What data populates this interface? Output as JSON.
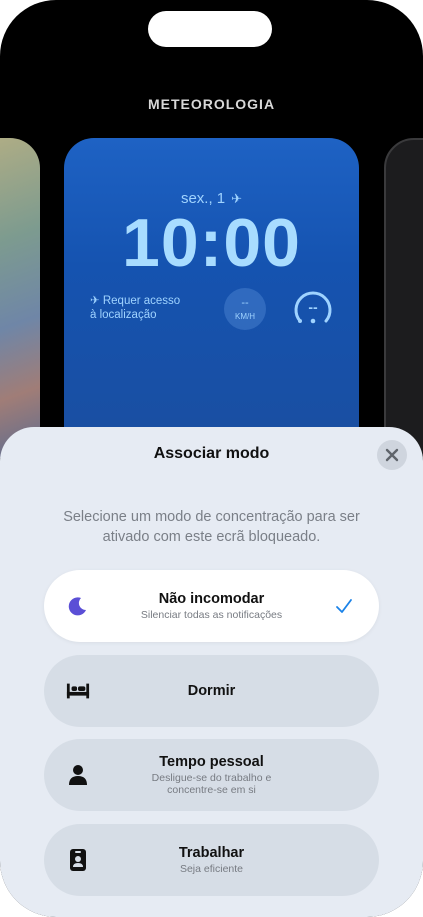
{
  "header": {
    "title": "METEOROLOGIA"
  },
  "lock_preview": {
    "date": "sex., 1",
    "time": "10:00",
    "location_text_line1": "Requer acesso",
    "location_text_line2": "à localização",
    "wind_value": "--",
    "wind_unit": "KM/H",
    "gauge_value": "--"
  },
  "sheet": {
    "title": "Associar modo",
    "description": "Selecione um modo de concentração para ser ativado com este ecrã bloqueado.",
    "close_icon": "xmark-icon",
    "modes": [
      {
        "name": "Não incomodar",
        "subtitle": "Silenciar todas as notificações",
        "icon": "moon-icon",
        "icon_color": "#5b4fd6",
        "selected": true
      },
      {
        "name": "Dormir",
        "subtitle": "",
        "icon": "bed-icon",
        "selected": false
      },
      {
        "name": "Tempo pessoal",
        "subtitle_line1": "Desligue-se do trabalho e",
        "subtitle_line2": "concentre-se em si",
        "icon": "person-icon",
        "selected": false
      },
      {
        "name": "Trabalhar",
        "subtitle": "Seja eficiente",
        "icon": "id-badge-icon",
        "selected": false
      }
    ]
  },
  "colors": {
    "accent": "#1a82e8",
    "preview_bg": "#1553b0",
    "preview_text": "#a8dcff",
    "sheet_bg": "#e6ebf3"
  }
}
